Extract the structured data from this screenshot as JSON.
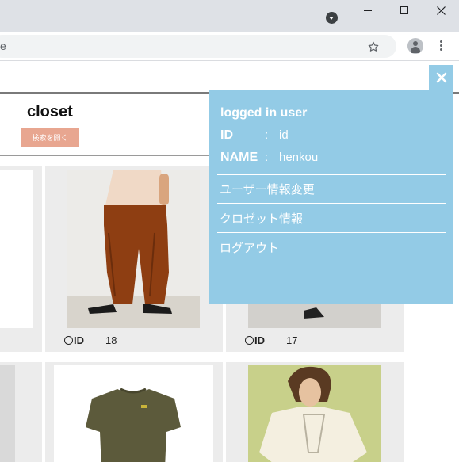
{
  "browser": {
    "address_text": "e"
  },
  "page": {
    "title": "closet",
    "search_button_label": "検索を開く"
  },
  "cards": [
    {
      "id_label": "ID",
      "id_value": "18"
    },
    {
      "id_label": "ID",
      "id_value": "17"
    }
  ],
  "user_panel": {
    "heading": "logged in user",
    "id_key": "ID",
    "id_value": "id",
    "name_key": "NAME",
    "name_value": "henkou",
    "colon": ":",
    "links": [
      "ユーザー情報変更",
      "クロゼット情報",
      "ログアウト"
    ],
    "close_label": "×"
  },
  "colors": {
    "panel_bg": "#93cbe6",
    "search_button_bg": "#e8a690",
    "card_bg": "#ececec"
  }
}
